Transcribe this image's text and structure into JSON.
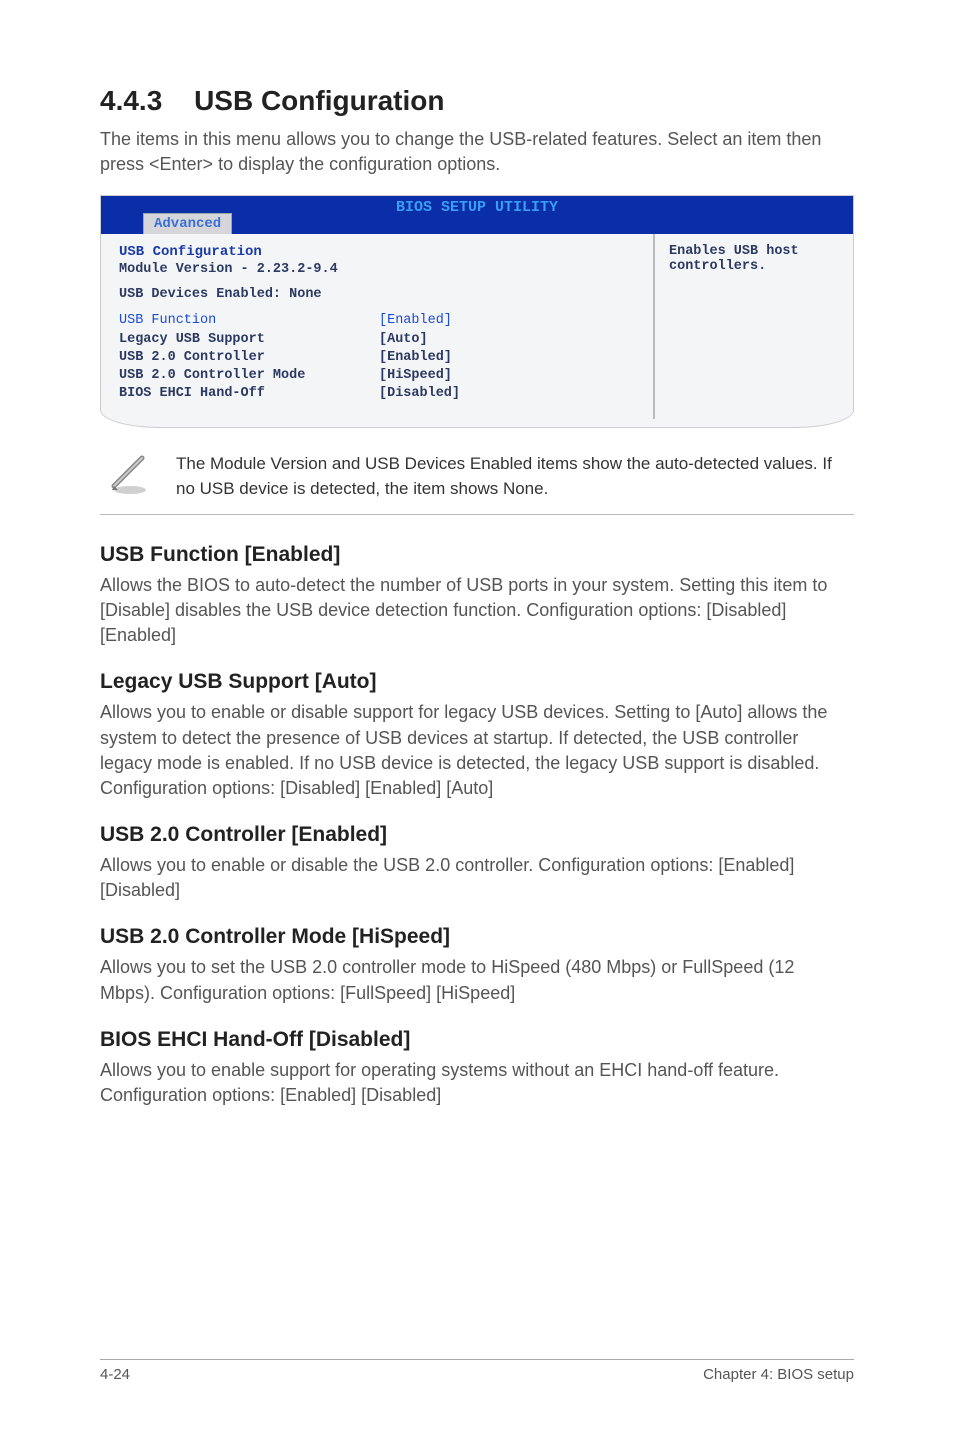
{
  "section": {
    "number": "4.4.3",
    "title": "USB Configuration",
    "intro": "The items in this menu allows you to change the USB-related features. Select an item then press <Enter> to display the configuration options."
  },
  "bios": {
    "banner": "BIOS SETUP UTILITY",
    "tab": "Advanced",
    "header": "USB Configuration",
    "module_version": "Module Version - 2.23.2-9.4",
    "devices_enabled": "USB Devices Enabled: None",
    "rows": [
      {
        "label": "USB Function",
        "value": "[Enabled]",
        "blue": true
      },
      {
        "label": "Legacy USB Support",
        "value": "[Auto]",
        "blue": false
      },
      {
        "label": "USB 2.0 Controller",
        "value": "[Enabled]",
        "blue": false
      },
      {
        "label": "USB 2.0 Controller Mode",
        "value": "[HiSpeed]",
        "blue": false
      },
      {
        "label": "BIOS EHCI Hand-Off",
        "value": "[Disabled]",
        "blue": false
      }
    ],
    "help": "Enables USB host controllers."
  },
  "note": {
    "text": "The Module Version and USB Devices Enabled items show the auto-detected values. If no USB device is detected, the item shows None."
  },
  "settings": [
    {
      "title": "USB Function [Enabled]",
      "body": "Allows the BIOS to auto-detect the number of USB ports in your system. Setting this item to [Disable] disables the USB device detection function. Configuration options: [Disabled] [Enabled]"
    },
    {
      "title": "Legacy USB Support [Auto]",
      "body": "Allows you to enable or disable support for legacy USB devices. Setting to [Auto] allows the system to detect the presence of USB devices at startup. If detected, the USB controller legacy mode is enabled. If no USB device is detected, the legacy USB support is disabled. Configuration options: [Disabled] [Enabled] [Auto]"
    },
    {
      "title": "USB 2.0 Controller [Enabled]",
      "body": "Allows you to enable or disable the USB 2.0 controller. Configuration options: [Enabled] [Disabled]"
    },
    {
      "title": "USB 2.0 Controller Mode [HiSpeed]",
      "body": "Allows you to set the USB 2.0 controller mode to HiSpeed (480 Mbps) or FullSpeed (12 Mbps). Configuration options: [FullSpeed] [HiSpeed]"
    },
    {
      "title": "BIOS EHCI Hand-Off [Disabled]",
      "body": "Allows you to enable support for operating systems without an EHCI hand-off feature. Configuration options: [Enabled] [Disabled]"
    }
  ],
  "footer": {
    "page": "4-24",
    "chapter": "Chapter 4: BIOS setup"
  }
}
